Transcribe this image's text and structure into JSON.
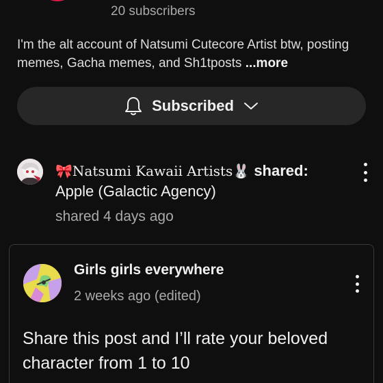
{
  "channel": {
    "subscribers": "20 subscribers",
    "description": "I'm the alt account of Natsumi Cutecore Artist btw, posting memes, Gacha memes, and Sh1tposts",
    "more_label": " ...more",
    "subscribe_label": "Subscribed"
  },
  "share": {
    "author": "🎀Natsumi Kawaii Artists🐰",
    "shared_label": " shared:",
    "shared_from": "Apple (Galactic Agency)",
    "time": "shared 4 days ago"
  },
  "original_post": {
    "author": "Girls girls everywhere",
    "time": "2 weeks ago (edited)",
    "body": "Share this post and I’ll rate your beloved character from 1 to 10"
  },
  "icons": {
    "bell": "bell-icon",
    "chevron": "chevron-down-icon",
    "menu": "more-vert-icon"
  },
  "colors": {
    "background": "#0f0f0f",
    "button_bg": "#272727",
    "secondary_text": "#aaaaaa"
  }
}
